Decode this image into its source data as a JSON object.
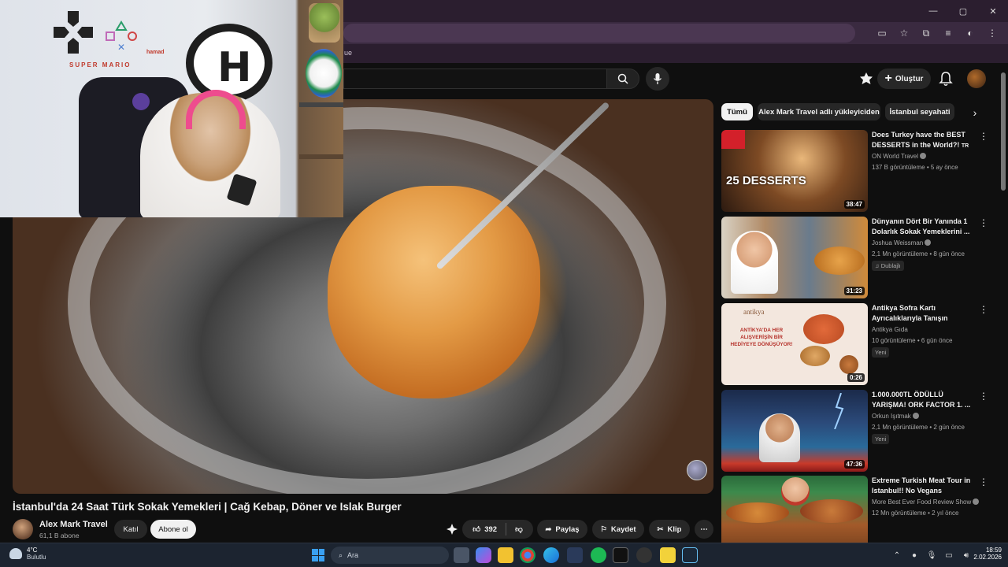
{
  "browser": {
    "bookmark_text": "ue",
    "window_controls": [
      "—",
      "▢",
      "✕"
    ]
  },
  "masthead": {
    "create_label": "Oluştur"
  },
  "video": {
    "title": "İstanbul'da 24 Saat Türk Sokak Yemekleri | Cağ Kebap, Döner ve Islak Burger",
    "channel": "Alex Mark Travel",
    "subscribers": "61,1 B abone",
    "join_label": "Katıl",
    "subscribe_label": "Abone ol",
    "likes": "392",
    "share_label": "Paylaş",
    "save_label": "Kaydet",
    "clip_label": "Klip"
  },
  "webcam": {
    "wall_text": "SUPER MARIO",
    "name_tag": "hamad"
  },
  "sidebar": {
    "chips": [
      "Tümü",
      "Alex Mark Travel adlı yükleyiciden",
      "İstanbul seyahati"
    ],
    "items": [
      {
        "title": "Does Turkey have the BEST DESSERTS in the World?!",
        "lang_tag": "TR",
        "channel": "ON World Travel",
        "views": "137 B görüntüleme • 5 ay önce",
        "duration": "38:47",
        "thumb_text": "25 DESSERTS",
        "badge": ""
      },
      {
        "title": "Dünyanın Dört Bir Yanında 1 Dolarlık Sokak Yemeklerini ...",
        "lang_tag": "",
        "channel": "Joshua Weissman",
        "views": "2,1 Mn görüntüleme • 8 gün önce",
        "duration": "31:23",
        "thumb_text": "",
        "badge": "Dublajlı"
      },
      {
        "title": "Antikya Sofra Kartı Ayrıcalıklarıyla Tanışın",
        "lang_tag": "",
        "channel": "Antikya Gıda",
        "views": "10 görüntüleme • 6 gün önce",
        "duration": "0:26",
        "thumb_text": "ANTİKYA'DA HER ALIŞVERİŞİN BİR HEDİYEYE DÖNÜŞÜYOR!",
        "thumb_brand": "antikya",
        "badge": "Yeni"
      },
      {
        "title": "1.000.000TL ÖDÜLLÜ YARIŞMA! ORK FACTOR 1. ...",
        "lang_tag": "",
        "channel": "Orkun Işıtmak",
        "views": "2,1 Mn görüntüleme • 2 gün önce",
        "duration": "47:36",
        "thumb_text": "",
        "badge": "Yeni"
      },
      {
        "title": "Extreme Turkish Meat Tour in Istanbul!! No Vegans Allowed!!",
        "lang_tag": "",
        "channel": "More Best Ever Food Review Show",
        "views": "12 Mn görüntüleme • 2 yıl önce",
        "duration": "",
        "thumb_text": "",
        "badge": ""
      }
    ]
  },
  "taskbar": {
    "temperature": "4°C",
    "weather": "Bulutlu",
    "search_label": "Ara",
    "time": "18:59",
    "date": "2.02.2026"
  }
}
